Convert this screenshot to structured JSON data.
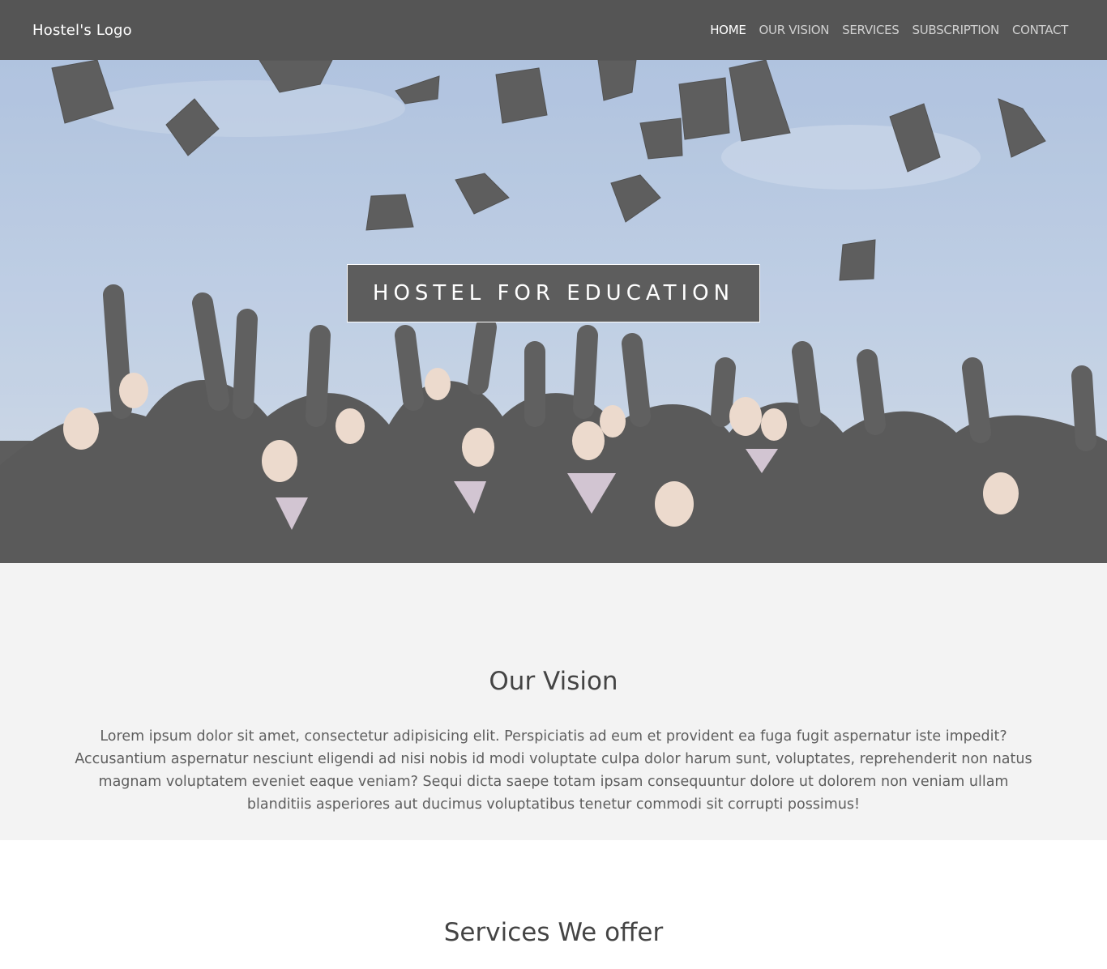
{
  "navbar": {
    "logo": "Hostel's Logo",
    "links": [
      "HOME",
      "OUR VISION",
      "SERVICES",
      "SUBSCRIPTION",
      "CONTACT"
    ],
    "active_index": 0
  },
  "hero": {
    "title": "HOSTEL FOR EDUCATION",
    "image": "graduates-throwing-caps-photo"
  },
  "vision": {
    "heading": "Our Vision",
    "body": "Lorem ipsum dolor sit amet, consectetur adipisicing elit. Perspiciatis ad eum et provident ea fuga fugit aspernatur iste impedit? Accusantium aspernatur nesciunt eligendi ad nisi nobis id modi voluptate culpa dolor harum sunt, voluptates, reprehenderit non natus magnam voluptatem eveniet eaque veniam? Sequi dicta saepe totam ipsam consequuntur dolore ut dolorem non veniam ullam blanditiis asperiores aut ducimus voluptatibus tenetur commodi sit corrupti possimus!"
  },
  "services": {
    "heading": "Services We offer"
  },
  "colors": {
    "navbar_bg": "#555555",
    "vision_bg": "#f3f3f3",
    "sky": "#a9bfdc",
    "gown": "#3a3a3a"
  }
}
